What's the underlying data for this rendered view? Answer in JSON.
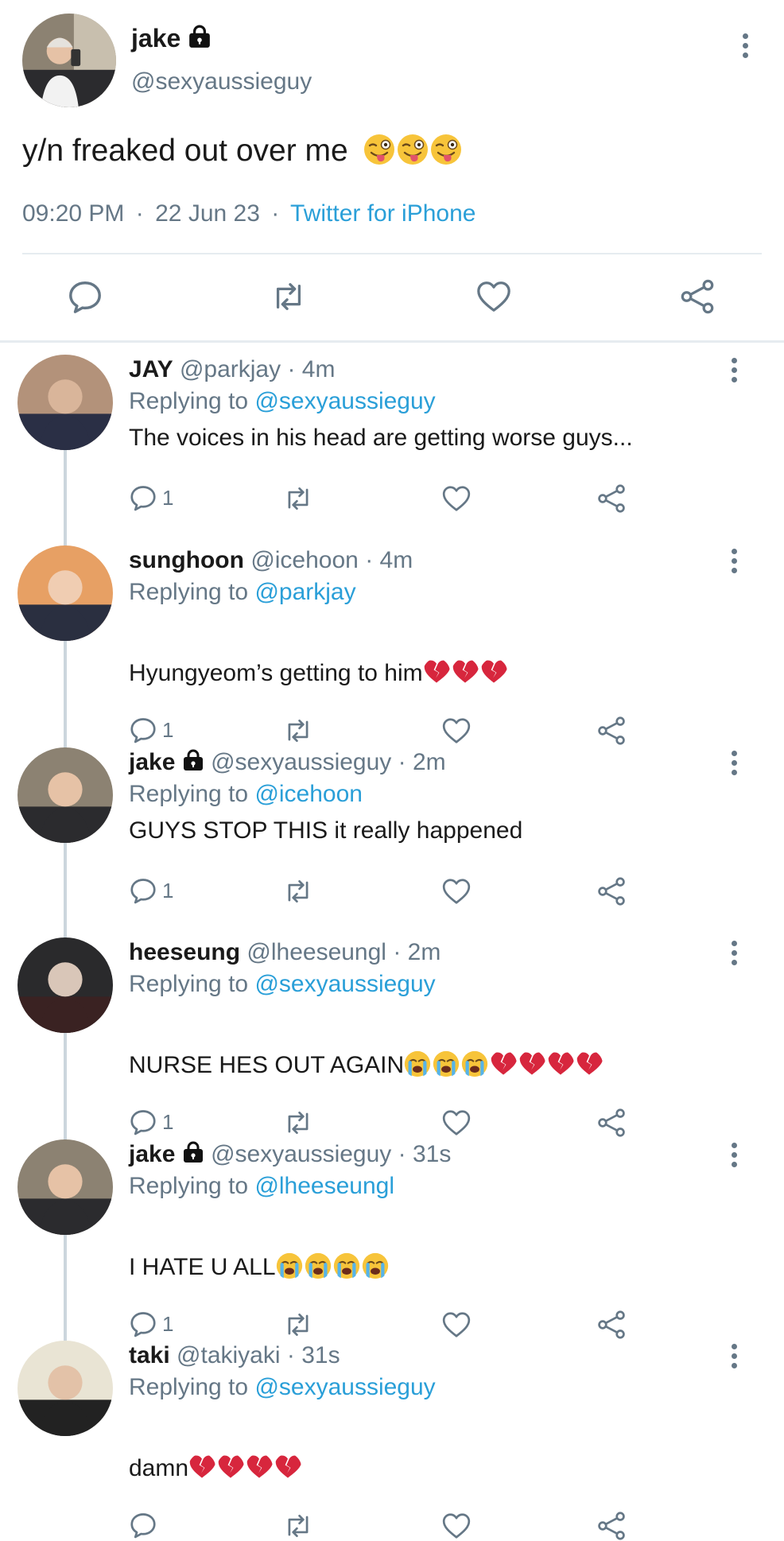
{
  "main_tweet": {
    "name": "jake",
    "handle": "@sexyaussieguy",
    "text": "y/n freaked out over me",
    "emoji": [
      "wink-tongue",
      "wink-tongue",
      "wink-tongue"
    ],
    "time": "09:20 PM",
    "sep1": "·",
    "date": "22 Jun 23",
    "sep2": "·",
    "source": "Twitter for iPhone"
  },
  "colors": {
    "link": "#2a9fd8",
    "muted": "#657786",
    "heart_broken": "#d7263d"
  },
  "replies": [
    {
      "name": "JAY",
      "handle": "@parkjay",
      "time": "· 4m",
      "replying_label": "Replying to",
      "replying_to": "@sexyaussieguy",
      "text": "The voices in his head are getting worse guys...",
      "emoji": [],
      "reply_count": "1"
    },
    {
      "name": "sunghoon",
      "handle": "@icehoon",
      "time": "· 4m",
      "replying_label": "Replying to",
      "replying_to": "@parkjay",
      "text": "Hyungyeom’s getting to him",
      "emoji": [
        "broken-heart",
        "broken-heart",
        "broken-heart"
      ],
      "reply_count": "1"
    },
    {
      "name": "jake",
      "handle": "@sexyaussieguy",
      "time": "· 2m",
      "replying_label": "Replying to",
      "replying_to": "@icehoon",
      "text": "GUYS STOP THIS it really happened",
      "emoji": [],
      "reply_count": "1"
    },
    {
      "name": "heeseung",
      "handle": "@lheeseungl",
      "time": "· 2m",
      "replying_label": "Replying to",
      "replying_to": "@sexyaussieguy",
      "text": "NURSE HES OUT AGAIN",
      "emoji": [
        "crying",
        "crying",
        "crying",
        "broken-heart",
        "broken-heart",
        "broken-heart",
        "broken-heart"
      ],
      "reply_count": "1"
    },
    {
      "name": "jake",
      "handle": "@sexyaussieguy",
      "time": "· 31s",
      "replying_label": "Replying to",
      "replying_to": "@lheeseungl",
      "text": "I HATE U ALL",
      "emoji": [
        "crying",
        "crying",
        "crying",
        "crying"
      ],
      "reply_count": "1"
    },
    {
      "name": "taki",
      "handle": "@takiyaki",
      "time": "· 31s",
      "replying_label": "Replying to",
      "replying_to": "@sexyaussieguy",
      "text": "damn",
      "emoji": [
        "broken-heart",
        "broken-heart",
        "broken-heart",
        "broken-heart"
      ],
      "reply_count": ""
    }
  ]
}
